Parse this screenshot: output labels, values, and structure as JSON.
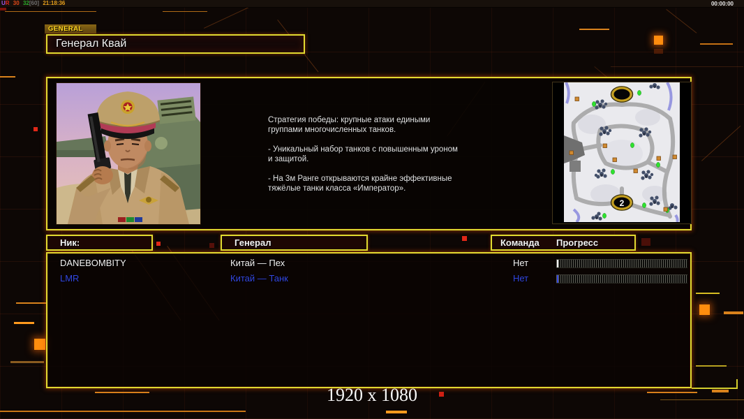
{
  "colors": {
    "accent_yellow": "#e0da30",
    "accent_orange": "#ff8d0e",
    "player1_color": "#f2f2f2",
    "player2_color": "#3347e0",
    "red_marker": "#e02818"
  },
  "top_bar": {
    "debug_u": "U",
    "debug_r": "R",
    "debug_fps": "30",
    "debug_cap": "32",
    "debug_bracket": "[60]",
    "debug_clock": "21:18:36",
    "match_timer": "00:00:00"
  },
  "header": {
    "tab_label": "GENERAL",
    "general_name": "Генерал Квай"
  },
  "briefing": {
    "paragraphs": [
      "Стратегия победы: крупные атаки едиными\n группами многочисленных танков.",
      "- Уникальный набор танков с повышенным уроном\n и защитой.",
      "- На 3м Ранге открываются крайне эффективные\n тяжёлые танки класса «Император»."
    ]
  },
  "minimap": {
    "start_marker_bottom": "2"
  },
  "lobby": {
    "col_nick": "Ник:",
    "col_general": "Генерал",
    "col_team": "Команда",
    "col_progress": "Прогресс",
    "players": [
      {
        "nick": "DANEBOMBITY",
        "general": "Китай — Пех",
        "team": "Нет",
        "progress_percent": 0,
        "color": "#f2f2f2"
      },
      {
        "nick": "LMR",
        "general": "Китай — Танк",
        "team": "Нет",
        "progress_percent": 0,
        "color": "#3347e0"
      }
    ]
  },
  "footer": {
    "resolution_label": "1920 x 1080"
  }
}
